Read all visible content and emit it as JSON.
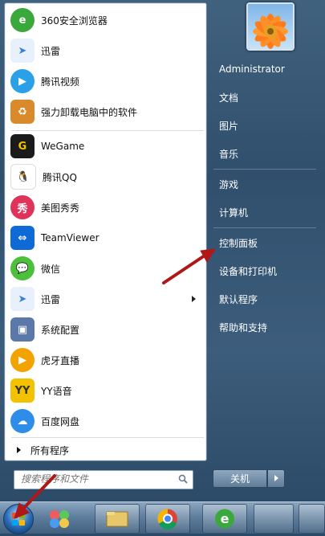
{
  "programs": [
    {
      "label": "360安全浏览器",
      "icon": "browser-360-icon",
      "color": "#3aa83a"
    },
    {
      "label": "迅雷",
      "icon": "thunder-icon",
      "color": "#3b7fd8"
    },
    {
      "label": "腾讯视频",
      "icon": "tencent-video-icon",
      "color": "#2aa0e8"
    },
    {
      "label": "强力卸载电脑中的软件",
      "icon": "uninstall-icon",
      "color": "#d98a2b"
    },
    {
      "label": "WeGame",
      "icon": "wegame-icon",
      "color": "#1b1b1b"
    },
    {
      "label": "腾讯QQ",
      "icon": "qq-icon",
      "color": "#222222"
    },
    {
      "label": "美图秀秀",
      "icon": "meitu-icon",
      "color": "#e0335a"
    },
    {
      "label": "TeamViewer",
      "icon": "teamviewer-icon",
      "color": "#0e6ad6"
    },
    {
      "label": "微信",
      "icon": "wechat-icon",
      "color": "#4cbf3c"
    },
    {
      "label": "迅雷",
      "icon": "thunder-icon",
      "color": "#3b7fd8"
    },
    {
      "label": "系统配置",
      "icon": "system-config-icon",
      "color": "#5a79a8"
    },
    {
      "label": "虎牙直播",
      "icon": "huya-icon",
      "color": "#f2a300"
    },
    {
      "label": "YY语音",
      "icon": "yy-icon",
      "color": "#f2c200"
    },
    {
      "label": "百度网盘",
      "icon": "baidu-netdisk-icon",
      "color": "#2e8de8"
    }
  ],
  "all_programs": "所有程序",
  "search": {
    "placeholder": "搜索程序和文件"
  },
  "right_links": {
    "user": "Administrator",
    "documents": "文档",
    "pictures": "图片",
    "music": "音乐",
    "games": "游戏",
    "computer": "计算机",
    "control_panel": "控制面板",
    "devices": "设备和打印机",
    "default_programs": "默认程序",
    "help": "帮助和支持"
  },
  "shutdown": {
    "label": "关机"
  },
  "colors": {
    "annotation_arrow": "#b01818",
    "menu_dark": "#2f4f6d"
  }
}
